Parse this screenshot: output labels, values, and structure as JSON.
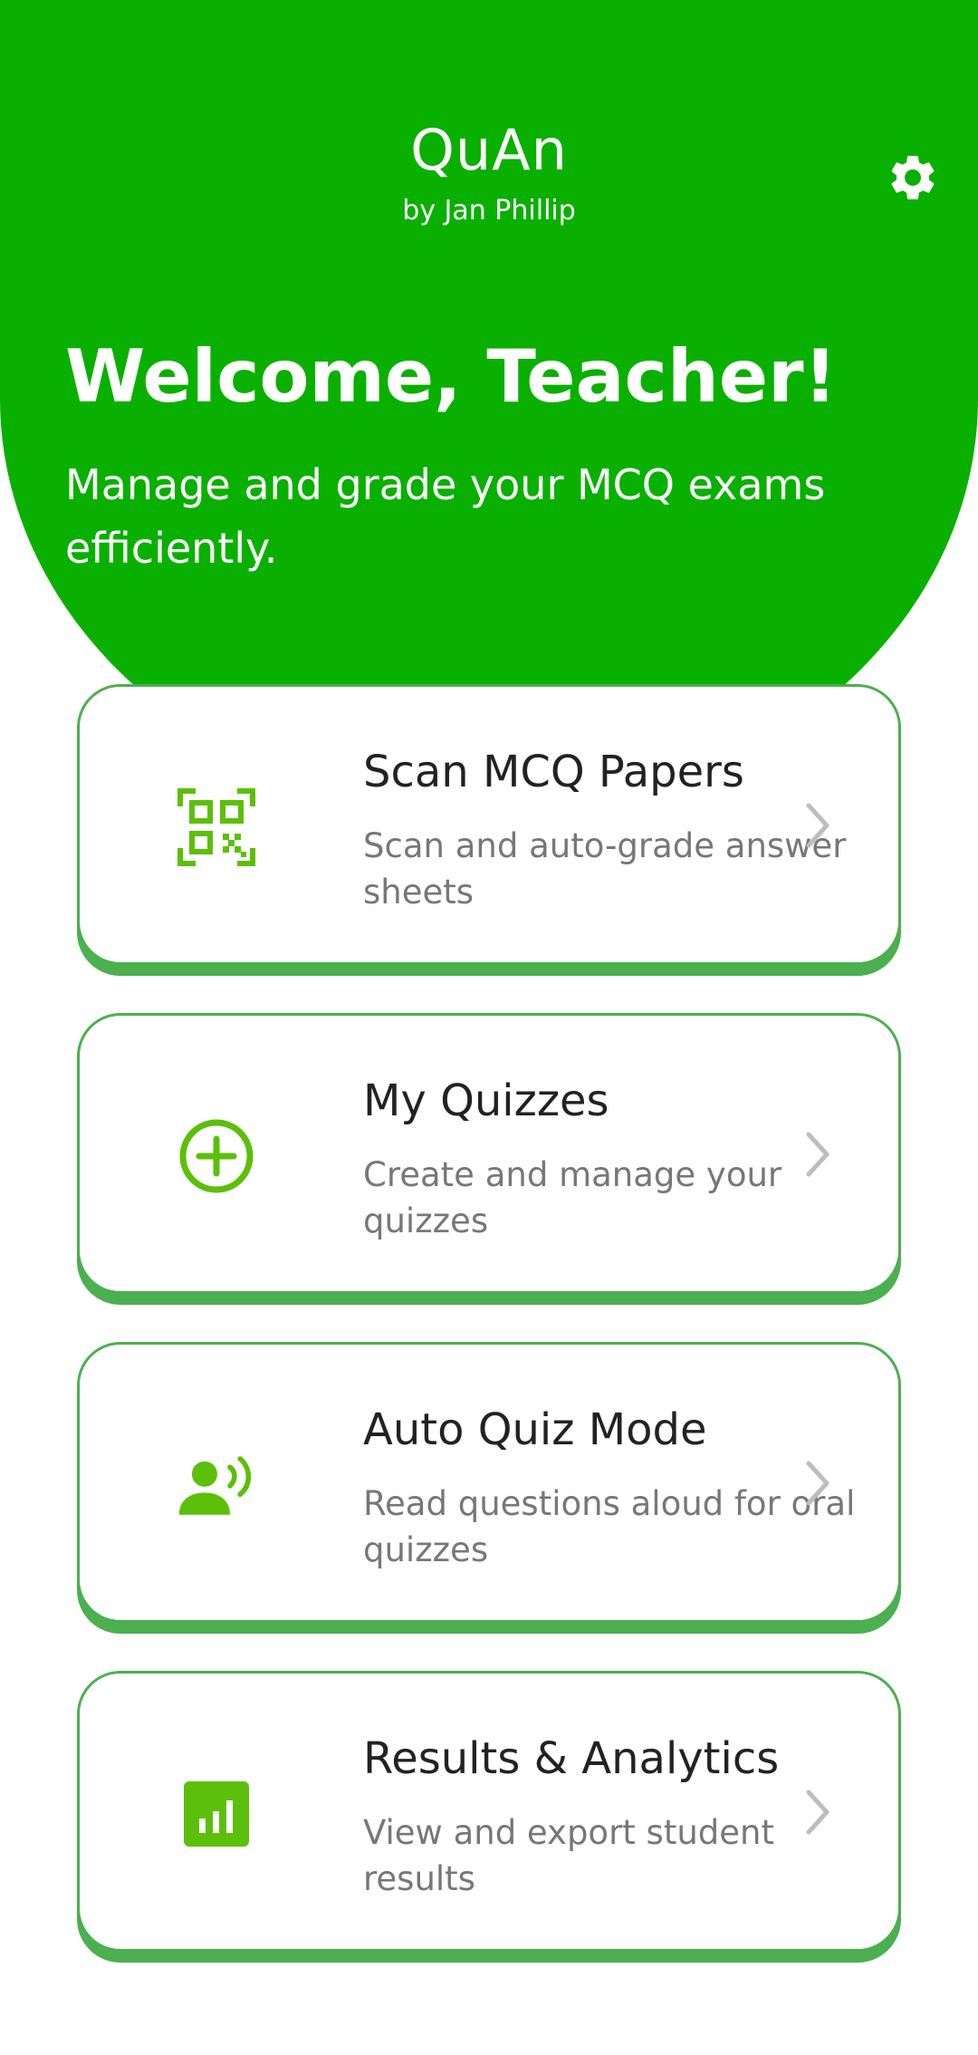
{
  "header": {
    "app_title": "QuAn",
    "app_subtitle": "by Jan Phillip",
    "settings_icon": "gear-icon"
  },
  "hero": {
    "welcome": "Welcome, Teacher!",
    "tagline": "Manage and grade your MCQ exams efficiently."
  },
  "cards": [
    {
      "title": "Scan MCQ Papers",
      "description": "Scan and auto-grade answer sheets",
      "icon": "qr-scan-icon"
    },
    {
      "title": "My Quizzes",
      "description": "Create and manage your quizzes",
      "icon": "add-circle-icon"
    },
    {
      "title": "Auto Quiz Mode",
      "description": "Read questions aloud for oral quizzes",
      "icon": "speaking-person-icon"
    },
    {
      "title": "Results & Analytics",
      "description": "View and export student results",
      "icon": "bar-chart-icon"
    }
  ],
  "colors": {
    "brand_green": "#09b000",
    "icon_green": "#5cbf0a",
    "card_border": "#4caf50",
    "title_text": "#222222",
    "desc_text": "#777777",
    "chevron": "#bdbdbd"
  }
}
